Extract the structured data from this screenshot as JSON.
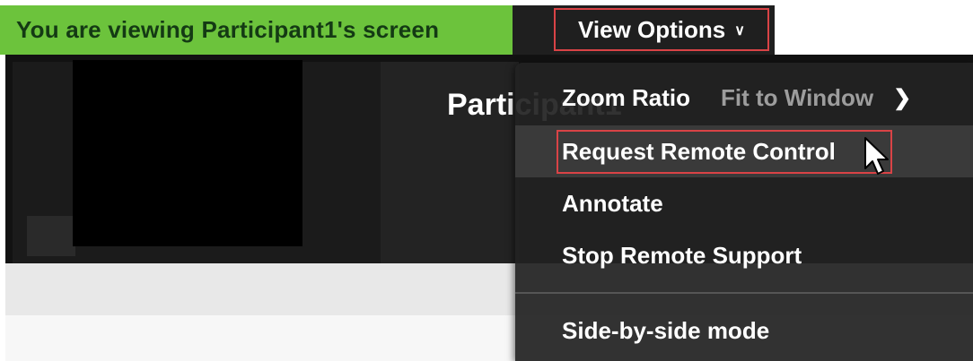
{
  "banner": {
    "text": "You are viewing Participant1's screen"
  },
  "view_options": {
    "label": "View Options",
    "chevron": "chevron-down-icon"
  },
  "share": {
    "participant_label": "Participant1"
  },
  "menu": {
    "items": [
      {
        "label": "Zoom Ratio",
        "value": "Fit to Window",
        "chevron": "chevron-right-icon"
      },
      {
        "label": "Request Remote Control"
      },
      {
        "label": "Annotate"
      },
      {
        "label": "Stop Remote Support"
      },
      {
        "label": "Side-by-side mode"
      }
    ]
  },
  "colors": {
    "banner_bg": "#6cc33c",
    "highlight_border": "#d94346",
    "menu_bg": "#222222"
  }
}
